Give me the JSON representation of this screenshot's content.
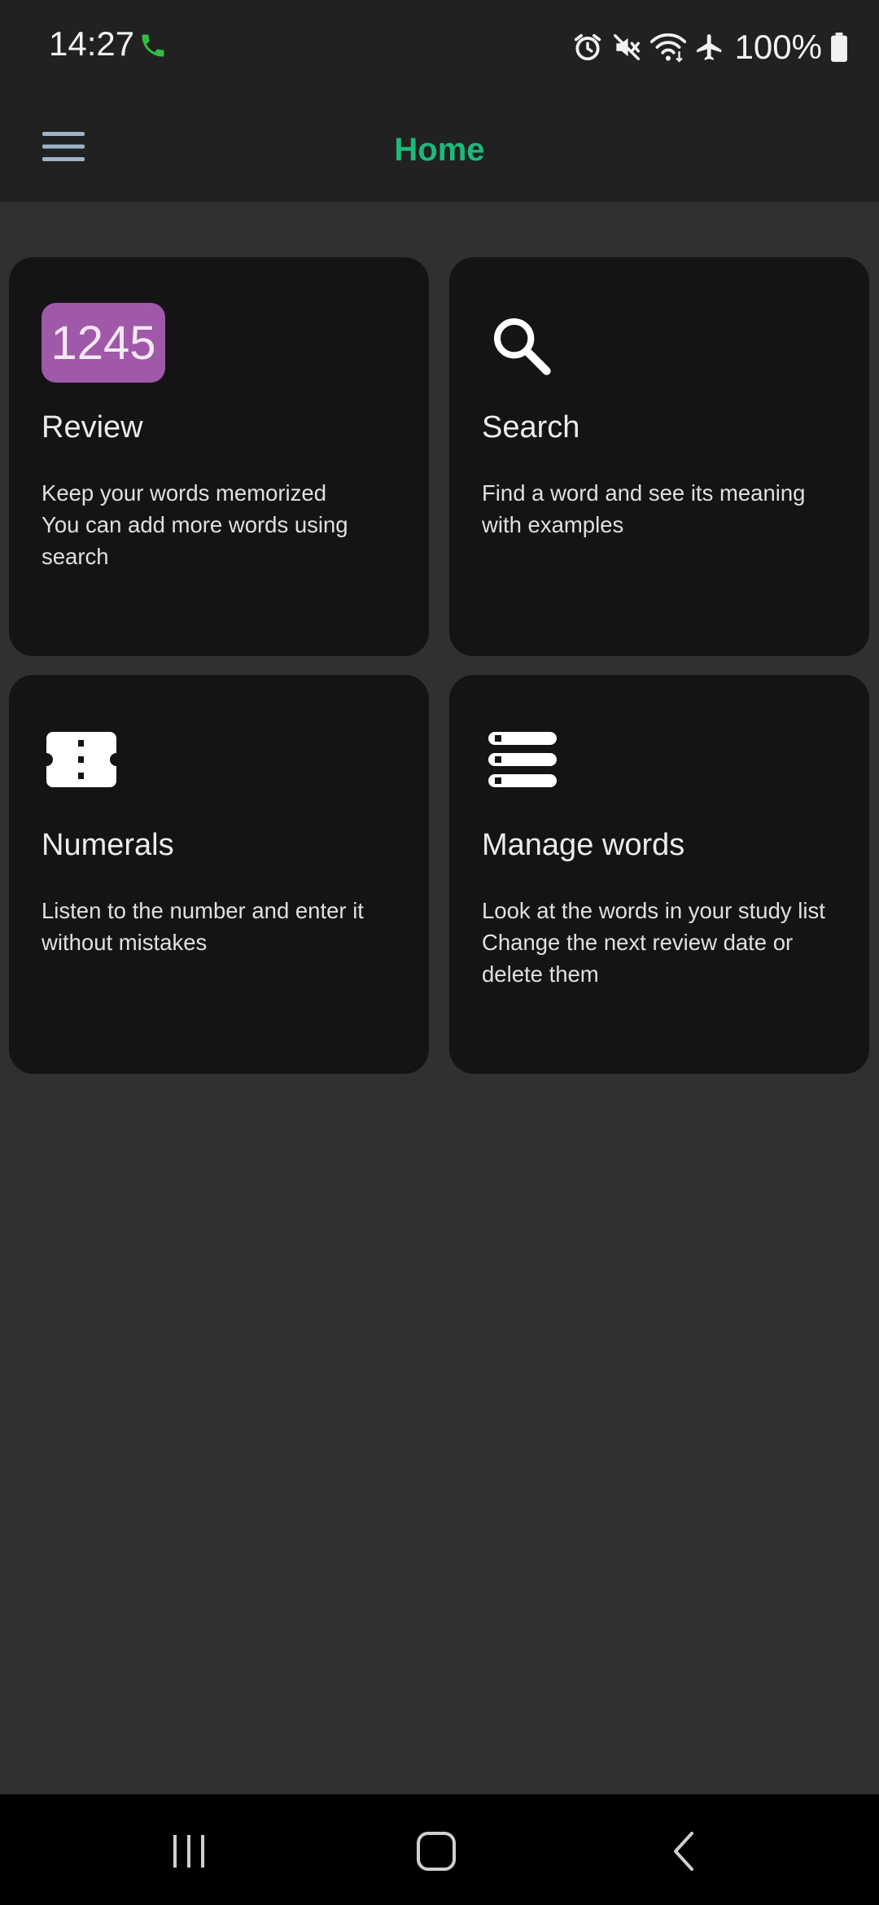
{
  "status_bar": {
    "time": "14:27",
    "battery": "100%",
    "icons": [
      "call-icon",
      "alarm-icon",
      "mute-icon",
      "wifi-icon",
      "airplane-icon",
      "battery-icon"
    ]
  },
  "app_bar": {
    "title": "Home",
    "menu_icon": "hamburger-menu-icon",
    "title_color": "#1db97a"
  },
  "cards": [
    {
      "badge": "1245",
      "title": "Review",
      "description": "Keep your words memorized\nYou can add more words using search",
      "badge_color": "#a058a8"
    },
    {
      "icon": "search-icon",
      "title": "Search",
      "description": "Find a word and see its meaning with examples"
    },
    {
      "icon": "ticket-icon",
      "title": "Numerals",
      "description": "Listen to the number and enter it without mistakes"
    },
    {
      "icon": "list-icon",
      "title": "Manage words",
      "description": "Look at the words in your study list\nChange the next review date or delete them"
    }
  ],
  "nav_bar": {
    "buttons": [
      "recent-apps-icon",
      "home-icon",
      "back-icon"
    ]
  }
}
